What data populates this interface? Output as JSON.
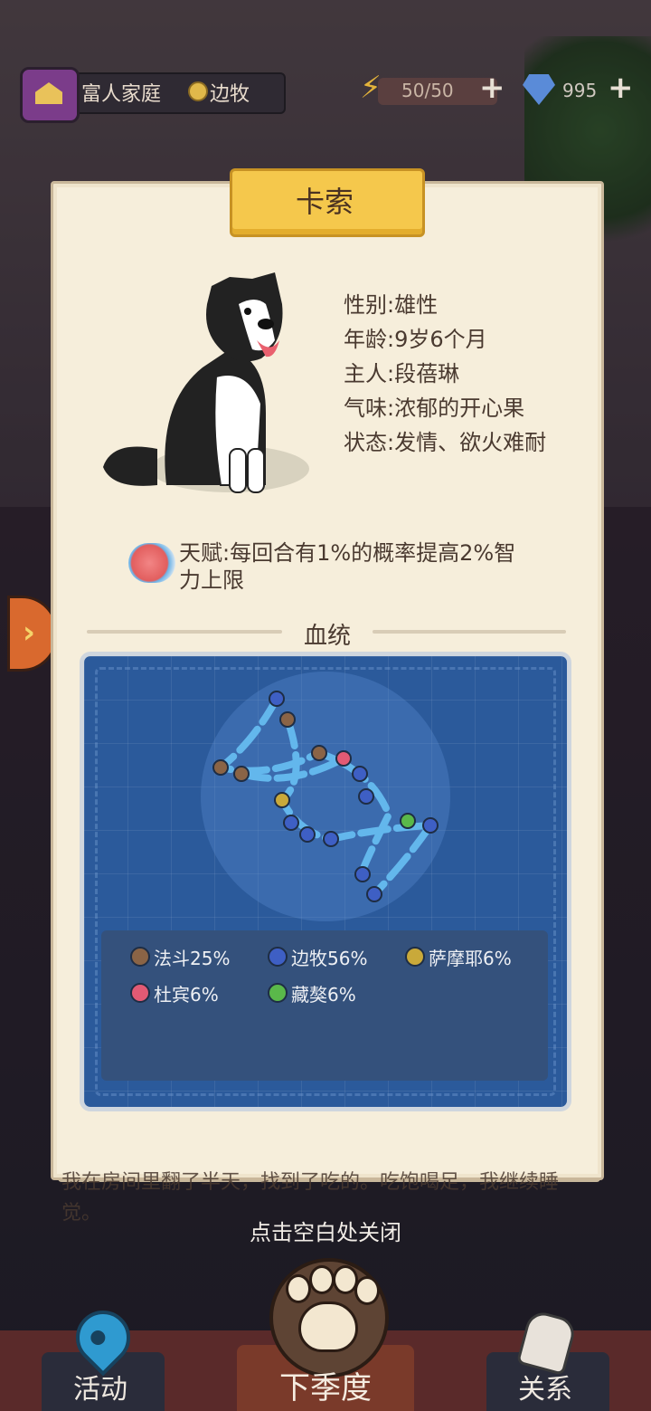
{
  "header": {
    "family_name": "富人家庭",
    "breed": "边牧",
    "energy": "50/50",
    "gems": "995",
    "plus": "+"
  },
  "card": {
    "title": "卡索",
    "info": {
      "gender": "性别:雄性",
      "age": "年龄:9岁6个月",
      "owner": "主人:段蓓琳",
      "scent": "气味:浓郁的开心果",
      "status": "状态:发情、欲火难耐"
    },
    "talent": "天赋:每回合有1%的概率提高2%智力上限",
    "section_title": "血统"
  },
  "lineage": [
    {
      "name": "法斗25%",
      "color": "#8a6446"
    },
    {
      "name": "边牧56%",
      "color": "#3e5fc4"
    },
    {
      "name": "萨摩耶6%",
      "color": "#c9a93a"
    },
    {
      "name": "杜宾6%",
      "color": "#e25a74"
    },
    {
      "name": "藏獒6%",
      "color": "#5ab84a"
    }
  ],
  "story": "我在房间里翻了半天，找到了吃的。吃饱喝足，我继续睡觉。",
  "close_hint": "点击空白处关闭",
  "nav": {
    "left": "活动",
    "center": "下季度",
    "right": "关系"
  },
  "icons": {
    "house": "house-badge-icon",
    "medal": "medal-icon",
    "energy": "lightning-icon",
    "gem": "diamond-icon",
    "arrow": "chevron-right-icon",
    "talent": "brain-icon",
    "pin": "map-pin-icon",
    "paw": "paw-icon",
    "hand": "hand-icon"
  }
}
